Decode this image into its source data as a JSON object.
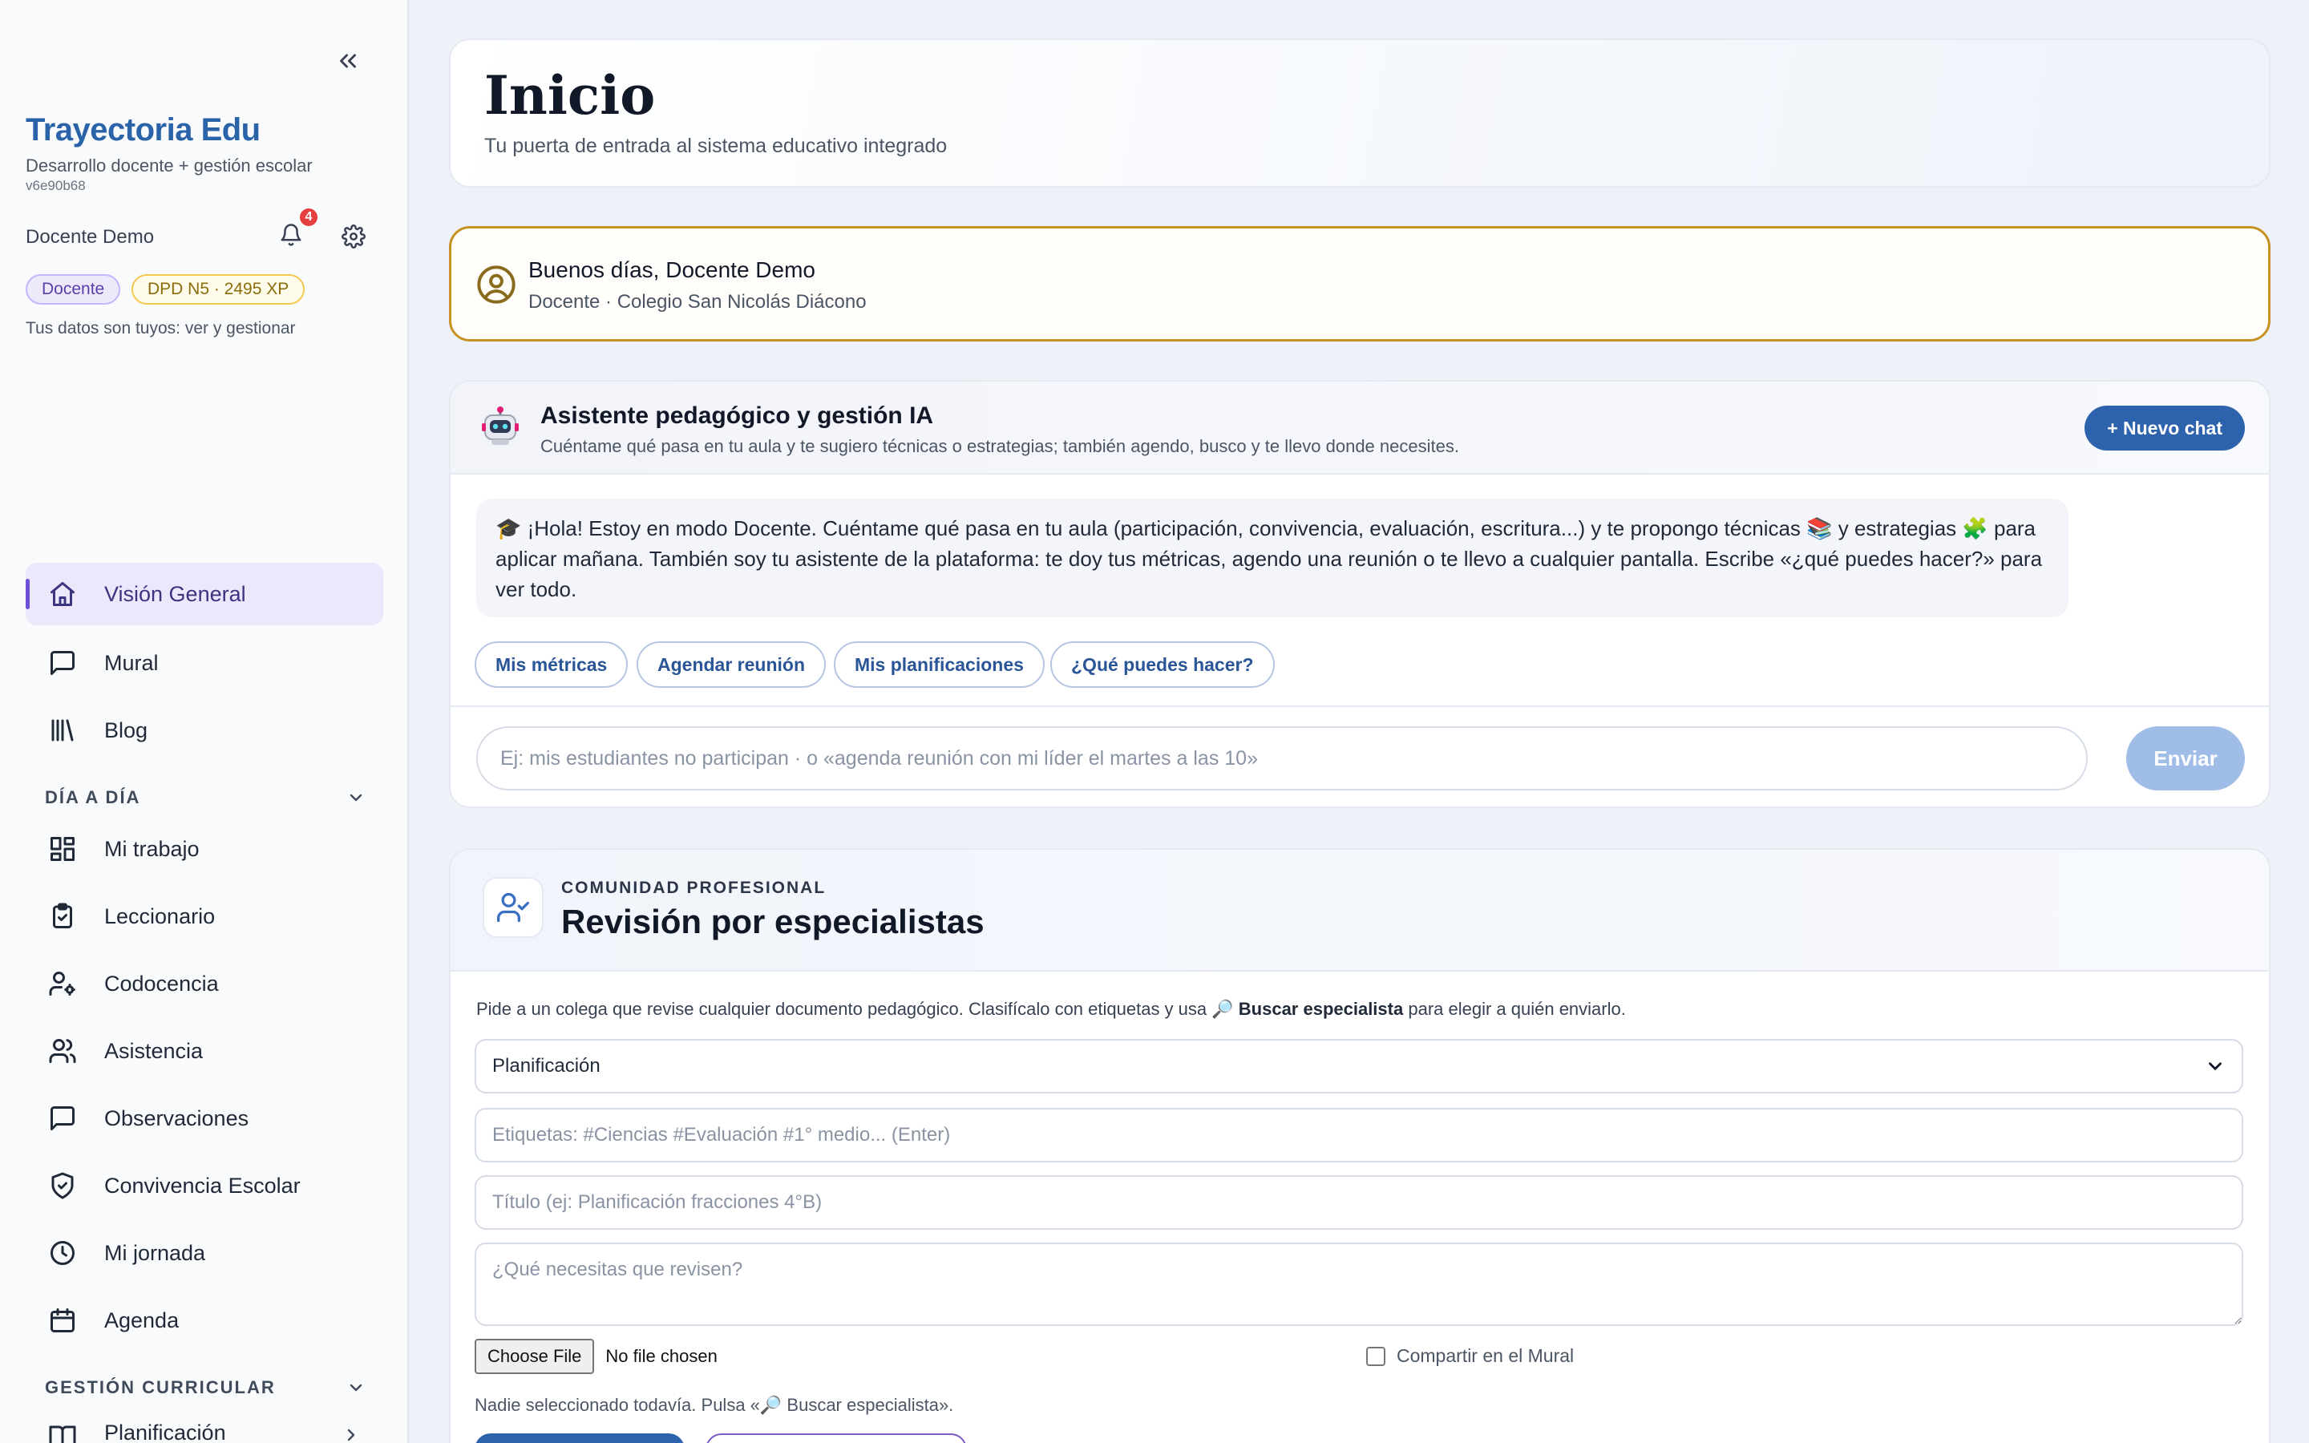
{
  "sidebar": {
    "brand_title": "Trayectoria Edu",
    "brand_subtitle": "Desarrollo docente + gestión escolar",
    "version": "v6e90b68",
    "user_name": "Docente Demo",
    "notification_count": "4",
    "role_badge": "Docente",
    "xp_badge": "DPD N5 · 2495 XP",
    "data_link": "Tus datos son tuyos: ver y gestionar",
    "nav_top": [
      {
        "label": "Visión General",
        "icon": "home-icon"
      },
      {
        "label": "Mural",
        "icon": "message-square-icon"
      },
      {
        "label": "Blog",
        "icon": "library-icon"
      }
    ],
    "section_daily": "DÍA A DÍA",
    "nav_daily": [
      {
        "label": "Mi trabajo",
        "icon": "dashboard-grid-icon"
      },
      {
        "label": "Leccionario",
        "icon": "clipboard-check-icon"
      },
      {
        "label": "Codocencia",
        "icon": "user-cog-icon"
      },
      {
        "label": "Asistencia",
        "icon": "users-icon"
      },
      {
        "label": "Observaciones",
        "icon": "message-square-icon"
      },
      {
        "label": "Convivencia Escolar",
        "icon": "shield-check-icon"
      },
      {
        "label": "Mi jornada",
        "icon": "clock-icon"
      },
      {
        "label": "Agenda",
        "icon": "calendar-icon"
      }
    ],
    "section_curricular": "GESTIÓN CURRICULAR",
    "nav_curricular": [
      {
        "label": "Planificación",
        "icon": "book-open-icon"
      }
    ]
  },
  "hero": {
    "title": "Inicio",
    "subtitle": "Tu puerta de entrada al sistema educativo integrado"
  },
  "greeting": {
    "title": "Buenos días, Docente Demo",
    "subtitle": "Docente · Colegio San Nicolás Diácono"
  },
  "assistant": {
    "title": "Asistente pedagógico y gestión IA",
    "subtitle": "Cuéntame qué pasa en tu aula y te sugiero técnicas o estrategias; también agendo, busco y te llevo donde necesites.",
    "new_chat_label": "+ Nuevo chat",
    "message": "🎓 ¡Hola! Estoy en modo Docente. Cuéntame qué pasa en tu aula (participación, convivencia, evaluación, escritura...) y te propongo técnicas 📚 y estrategias 🧩 para aplicar mañana. También soy tu asistente de la plataforma: te doy tus métricas, agendo una reunión o te llevo a cualquier pantalla. Escribe «¿qué puedes hacer?» para ver todo.",
    "quick_actions": [
      "Mis métricas",
      "Agendar reunión",
      "Mis planificaciones",
      "¿Qué puedes hacer?"
    ],
    "input_placeholder": "Ej: mis estudiantes no participan · o «agenda reunión con mi líder el martes a las 10»",
    "send_label": "Enviar"
  },
  "review": {
    "kicker": "COMUNIDAD PROFESIONAL",
    "title": "Revisión por especialistas",
    "desc_before": "Pide a un colega que revise cualquier documento pedagógico. Clasifícalo con etiquetas y usa 🔎 ",
    "desc_bold": "Buscar especialista",
    "desc_after": " para elegir a quién enviarlo.",
    "doc_type_selected": "Planificación",
    "tags_placeholder": "Etiquetas: #Ciencias #Evaluación #1° medio... (Enter)",
    "title_placeholder": "Título (ej: Planificación fracciones 4°B)",
    "request_placeholder": "¿Qué necesitas que revisen?",
    "file_button": "Choose File",
    "file_status": "No file chosen",
    "share_label": "Compartir en el Mural",
    "status_text": "Nadie seleccionado todavía. Pulsa «🔎 Buscar especialista»."
  }
}
